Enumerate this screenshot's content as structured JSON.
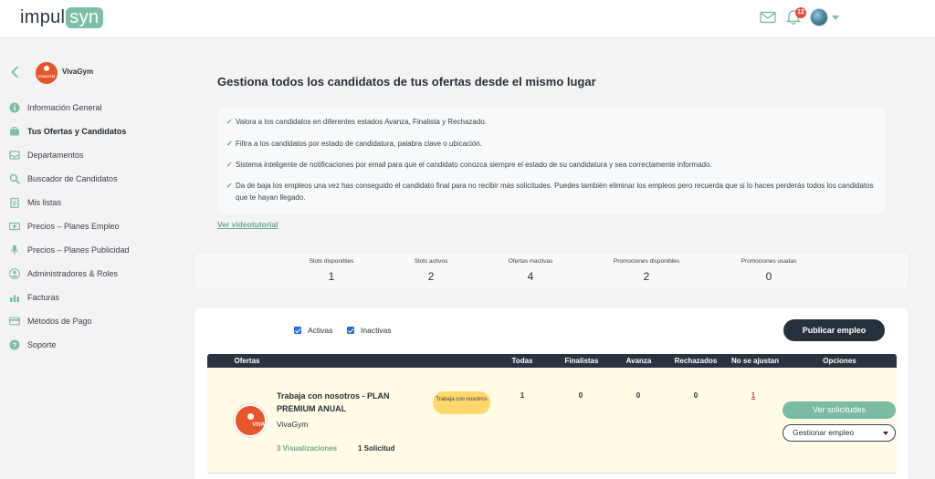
{
  "header": {
    "logo_plain": "impul",
    "logo_boxed": "syn",
    "notifications_count": "12",
    "icons": [
      "mail-icon",
      "bell-icon",
      "avatar",
      "chevron-down-icon"
    ]
  },
  "sidebar": {
    "company_name": "VivaGym",
    "company_logo_text": "VIVAGYM",
    "items": [
      {
        "label": "Información General",
        "icon": "info-icon",
        "active": false
      },
      {
        "label": "Tus Ofertas y Candidatos",
        "icon": "briefcase-icon",
        "active": true
      },
      {
        "label": "Departamentos",
        "icon": "inbox-icon",
        "active": false
      },
      {
        "label": "Buscador de Candidatos",
        "icon": "search-icon",
        "active": false
      },
      {
        "label": "Mis listas",
        "icon": "clipboard-icon",
        "active": false
      },
      {
        "label": "Precios – Planes Empleo",
        "icon": "money-icon",
        "active": false
      },
      {
        "label": "Precios – Planes Publicidad",
        "icon": "microphone-icon",
        "active": false
      },
      {
        "label": "Administradores & Roles",
        "icon": "users-icon",
        "active": false
      },
      {
        "label": "Facturas",
        "icon": "chart-icon",
        "active": false
      },
      {
        "label": "Métodos de Pago",
        "icon": "credit-card-icon",
        "active": false
      },
      {
        "label": "Soporte",
        "icon": "help-icon",
        "active": false
      }
    ]
  },
  "intro": {
    "title": "Gestiona todos los candidatos de tus ofertas desde el mismo lugar",
    "features": [
      "Valora a los candidatos en diferentes estados Avanza, Finalista y Rechazado.",
      "Filtra a los candidatos por estado de candidatura, palabra clave o ubicación.",
      "Sistema inteligente de notificaciones por email para que el candidato conozca siempre el estado de su candidatura y sea correctamente informado.",
      "Da de baja los empleos una vez has conseguido el candidato final para no recibir más solicitudes. Puedes también eliminar los empleos pero recuerda que si lo haces perderás todos los candidatos que te hayan llegado."
    ],
    "tutorial_link": "Ver videotutorial"
  },
  "stats": [
    {
      "label": "Slots disponibles",
      "value": "1"
    },
    {
      "label": "Slots activos",
      "value": "2"
    },
    {
      "label": "Ofertas inactivas",
      "value": "4"
    },
    {
      "label": "Promociones disponibles",
      "value": "2"
    },
    {
      "label": "Promociones usadas",
      "value": "0"
    }
  ],
  "offers": {
    "filters": {
      "active_label": "Activas",
      "inactive_label": "Inactivas",
      "active_checked": true,
      "inactive_checked": true
    },
    "publish_button": "Publicar empleo",
    "columns": [
      "Ofertas",
      "Todas",
      "Finalistas",
      "Avanza",
      "Rechazados",
      "No se ajustan",
      "Opciones"
    ],
    "rows": [
      {
        "logo_text": "VIVAGYM",
        "title": "Trabaja con nosotros - PLAN PREMIUM ANUAL",
        "company": "VivaGym",
        "badge": "Trabaja con nosotros",
        "todas": "1",
        "finalistas": "0",
        "avanza": "0",
        "rechazados": "0",
        "no_se_ajustan": "1",
        "views": "3 Visualizaciones",
        "requests": "1 Solicitud",
        "view_button": "Ver solicitudes",
        "manage_select": "Gestionar empleo"
      }
    ]
  },
  "colors": {
    "accent": "#7bbfa5",
    "dark": "#26313d",
    "row_highlight": "#fffbe5",
    "badge": "#ffd86b",
    "link_red": "#c4452e"
  }
}
